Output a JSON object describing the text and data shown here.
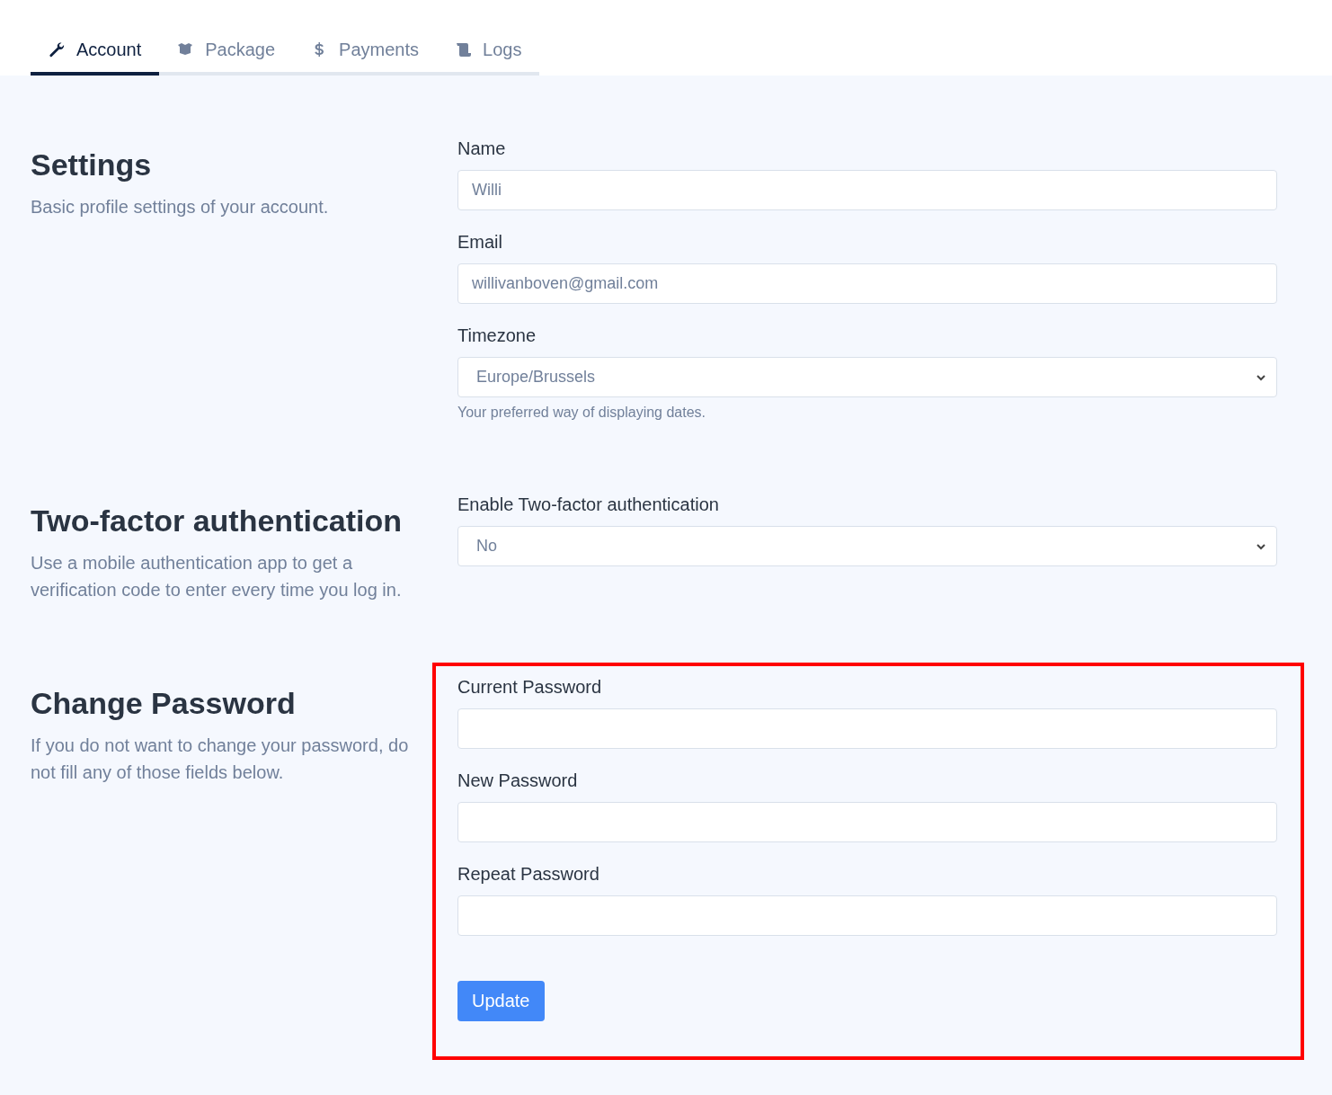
{
  "tabs": [
    {
      "label": "Account",
      "selected": true
    },
    {
      "label": "Package",
      "selected": false
    },
    {
      "label": "Payments",
      "selected": false
    },
    {
      "label": "Logs",
      "selected": false
    }
  ],
  "sections": [
    {
      "title": "Settings",
      "description": "Basic profile settings of your account.",
      "highlighted": false,
      "fields": [
        {
          "kind": "text",
          "label": "Name",
          "value": "Willi"
        },
        {
          "kind": "text",
          "label": "Email",
          "value": "willivanboven@gmail.com"
        },
        {
          "kind": "select",
          "label": "Timezone",
          "value": "Europe/Brussels",
          "hint": "Your preferred way of displaying dates."
        }
      ]
    },
    {
      "title": "Two-factor authentication",
      "description": "Use a mobile authentication app to get a verification code to enter every time you log in.",
      "highlighted": false,
      "fields": [
        {
          "kind": "select",
          "label": "Enable Two-factor authentication",
          "value": "No"
        }
      ]
    },
    {
      "title": "Change Password",
      "description": "If you do not want to change your password, do not fill any of those fields below.",
      "highlighted": true,
      "fields": [
        {
          "kind": "password",
          "label": "Current Password"
        },
        {
          "kind": "password",
          "label": "New Password"
        },
        {
          "kind": "password",
          "label": "Repeat Password"
        }
      ],
      "button": "Update"
    }
  ]
}
